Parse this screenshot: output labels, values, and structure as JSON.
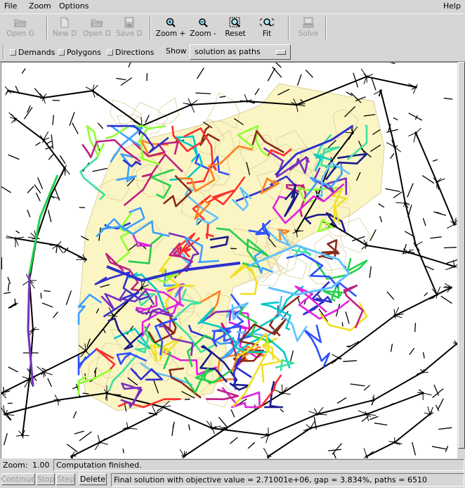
{
  "menubar": {
    "file": "File",
    "zoom": "Zoom",
    "options": "Options",
    "help": "Help"
  },
  "toolbar": {
    "buttons": [
      {
        "label": "Open G",
        "icon": "open-folder-icon",
        "enabled": false
      },
      {
        "label": "New D",
        "icon": "new-file-icon",
        "enabled": false
      },
      {
        "label": "Open D",
        "icon": "open-folder-icon",
        "enabled": false
      },
      {
        "label": "Save D",
        "icon": "floppy-disk-icon",
        "enabled": false
      },
      {
        "label": "Zoom +",
        "icon": "zoom-in-icon",
        "enabled": true
      },
      {
        "label": "Zoom -",
        "icon": "zoom-out-icon",
        "enabled": true
      },
      {
        "label": "Reset",
        "icon": "zoom-reset-icon",
        "enabled": true
      },
      {
        "label": "Fit",
        "icon": "zoom-fit-icon",
        "enabled": true
      },
      {
        "label": "Solve",
        "icon": "computer-icon",
        "enabled": false
      }
    ]
  },
  "options_bar": {
    "demands": "Demands",
    "polygons": "Polygons",
    "directions": "Directions",
    "show_label": "Show",
    "show_value": "solution as paths"
  },
  "zoom": {
    "label": "Zoom:",
    "value": "1.00",
    "status": "Computation finished."
  },
  "bottom": {
    "continue": "Continue",
    "stop": "Stop",
    "step": "Step",
    "delete": "Delete",
    "message": "Final solution with objective value = 2.71001e+06, gap = 3.834%, paths = 6510"
  },
  "colors": {
    "background": "#d6d6d6",
    "canvas": "#ffffff",
    "polygon_fill": "#fbf5c4",
    "network": "#000000"
  }
}
